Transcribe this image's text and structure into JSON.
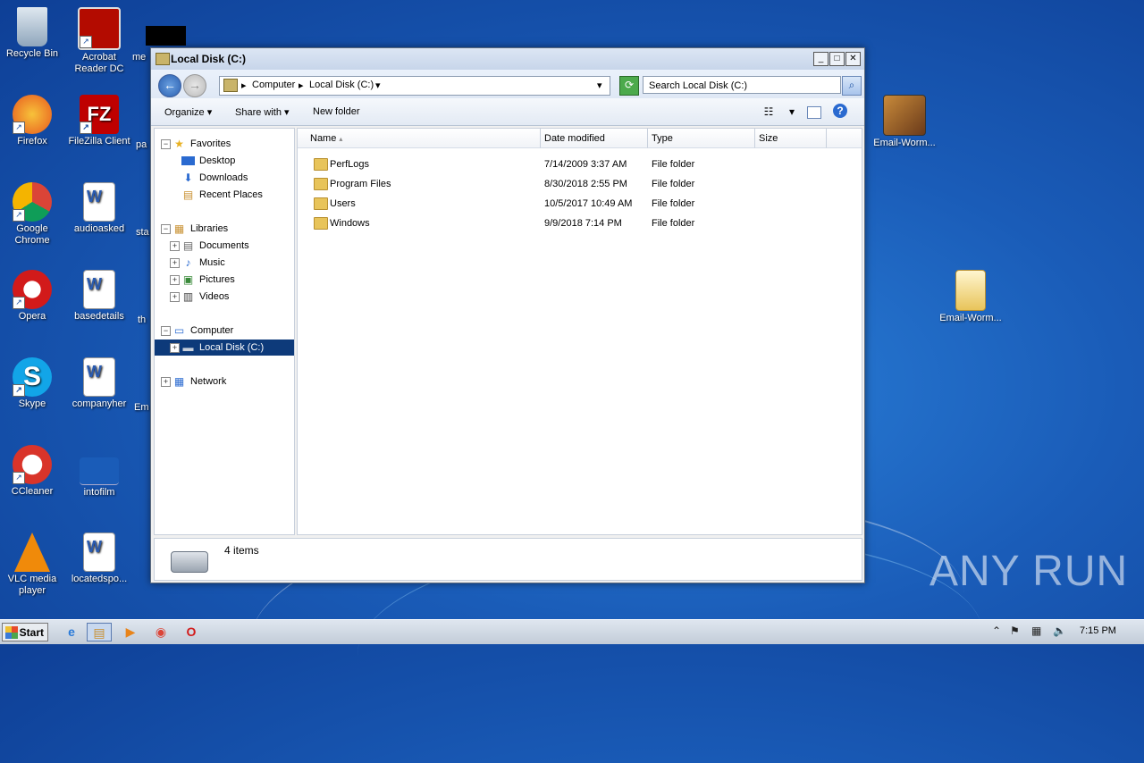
{
  "desktop": {
    "icons": [
      {
        "label": "Recycle Bin"
      },
      {
        "label": "Acrobat Reader DC"
      },
      {
        "label": "Firefox"
      },
      {
        "label": "FileZilla Client"
      },
      {
        "label": "Google Chrome"
      },
      {
        "label": "audioasked"
      },
      {
        "label": "Opera"
      },
      {
        "label": "basedetails"
      },
      {
        "label": "Skype"
      },
      {
        "label": "companyher"
      },
      {
        "label": "CCleaner"
      },
      {
        "label": "intofilm"
      },
      {
        "label": "VLC media player"
      },
      {
        "label": "locatedspo..."
      },
      {
        "label": "Email-Worm..."
      },
      {
        "label": "Email-Worm..."
      }
    ],
    "partial_labels": [
      "me",
      "pa",
      "sta",
      "th",
      "Em"
    ],
    "watermark": "ANY RUN"
  },
  "window": {
    "title": "Local Disk (C:)",
    "controls": {
      "minimize": "_",
      "maximize": "□",
      "close": "✕"
    },
    "breadcrumb": [
      "Computer",
      "Local Disk (C:)"
    ],
    "search_placeholder": "Search Local Disk (C:)",
    "toolbar": {
      "organize": "Organize",
      "share": "Share with",
      "new_folder": "New folder"
    },
    "nav": {
      "favorites": "Favorites",
      "favorites_items": [
        "Desktop",
        "Downloads",
        "Recent Places"
      ],
      "libraries": "Libraries",
      "library_items": [
        "Documents",
        "Music",
        "Pictures",
        "Videos"
      ],
      "computer": "Computer",
      "local_disk": "Local Disk (C:)",
      "network": "Network"
    },
    "columns": [
      "Name",
      "Date modified",
      "Type",
      "Size"
    ],
    "rows": [
      {
        "name": "PerfLogs",
        "date": "7/14/2009 3:37 AM",
        "type": "File folder",
        "size": ""
      },
      {
        "name": "Program Files",
        "date": "8/30/2018 2:55 PM",
        "type": "File folder",
        "size": ""
      },
      {
        "name": "Users",
        "date": "10/5/2017 10:49 AM",
        "type": "File folder",
        "size": ""
      },
      {
        "name": "Windows",
        "date": "9/9/2018 7:14 PM",
        "type": "File folder",
        "size": ""
      }
    ],
    "status": "4 items"
  },
  "taskbar": {
    "start": "Start",
    "clock": "7:15 PM"
  }
}
